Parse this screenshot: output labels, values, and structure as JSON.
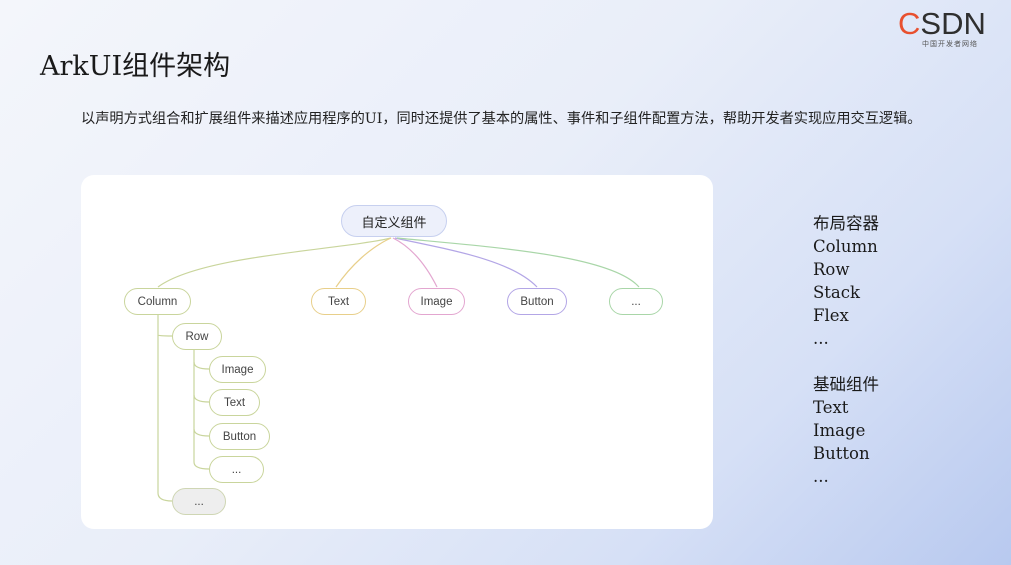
{
  "logo": {
    "brand": "CSDN",
    "brand_first": "C",
    "brand_rest": "SDN",
    "subtitle": "中国开发者网络"
  },
  "slide": {
    "title": "ArkUI组件架构",
    "description": "以声明方式组合和扩展组件来描述应用程序的UI，同时还提供了基本的属性、事件和子组件配置方法，帮助开发者实现应用交互逻辑。"
  },
  "diagram": {
    "root": "自定义组件",
    "children": [
      "Column",
      "Text",
      "Image",
      "Button",
      "..."
    ],
    "column_children": [
      "Row",
      "..."
    ],
    "row_children": [
      "Image",
      "Text",
      "Button",
      "..."
    ]
  },
  "side_lists": [
    {
      "heading": "布局容器",
      "items": [
        "Column",
        "Row",
        "Stack",
        "Flex",
        "..."
      ]
    },
    {
      "heading": "基础组件",
      "items": [
        "Text",
        "Image",
        "Button",
        "..."
      ]
    }
  ],
  "colors": {
    "accent_orange": "#e8502f",
    "edge_column": "#c9d59c",
    "edge_text": "#e8cf8a",
    "edge_image": "#e3a6d0",
    "edge_button": "#b3a6e6",
    "edge_more": "#a9d6a8",
    "root_fill": "#edf0fb"
  }
}
